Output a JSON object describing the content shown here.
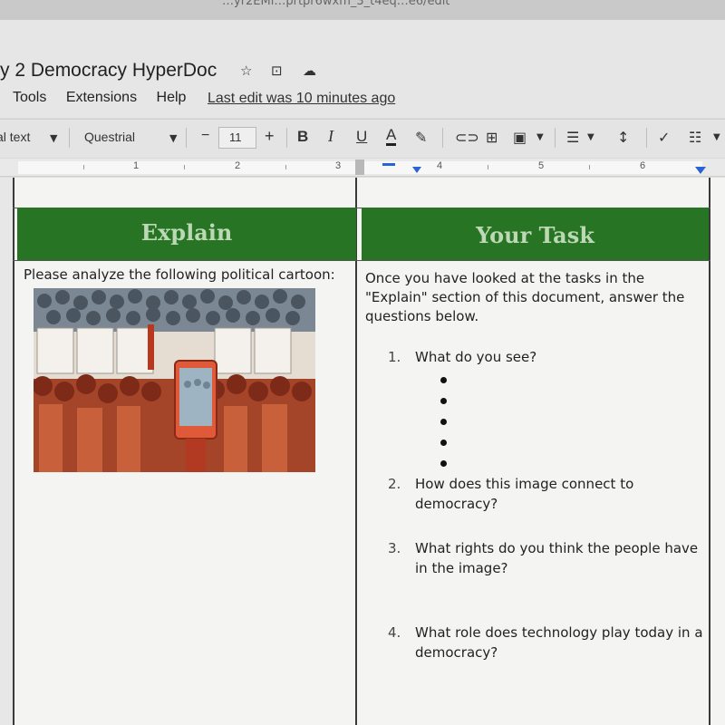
{
  "browser": {
    "url_fragment": "…yr2EMi…prtpr6wxm_3_t4eq…e6/edit"
  },
  "doc": {
    "title": "y 2 Democracy HyperDoc",
    "menus": [
      "Tools",
      "Extensions",
      "Help"
    ],
    "last_edit": "Last edit was 10 minutes ago"
  },
  "toolbar": {
    "style": "al text",
    "font": "Questrial",
    "minus": "−",
    "font_size": "11",
    "plus": "+",
    "bold": "B",
    "italic": "I",
    "underline": "U",
    "text_color": "A"
  },
  "ruler": {
    "numbers": [
      "1",
      "2",
      "3",
      "4",
      "5",
      "6"
    ]
  },
  "table": {
    "explain": {
      "header": "Explain",
      "body": "Please analyze the following political cartoon:"
    },
    "task": {
      "header": "Your Task",
      "intro": "Once you have looked at the tasks in the \"Explain\" section of this document, answer the questions below.",
      "questions": [
        {
          "num": "1.",
          "text": "What do you see?"
        },
        {
          "num": "2.",
          "text": "How does this image connect to democracy?"
        },
        {
          "num": "3.",
          "text": "What rights do you think the people have in the image?"
        },
        {
          "num": "4.",
          "text": "What role does technology play today in a democracy?"
        }
      ]
    }
  },
  "colors": {
    "header_green": "#277424",
    "header_text": "#bcd8b5"
  },
  "icons": [
    "star-icon",
    "move-to-folder-icon",
    "cloud-saved-icon",
    "paint-format-icon",
    "link-icon",
    "add-comment-icon",
    "insert-image-icon",
    "align-icon",
    "line-spacing-icon",
    "checklist-icon",
    "bulleted-list-icon"
  ]
}
